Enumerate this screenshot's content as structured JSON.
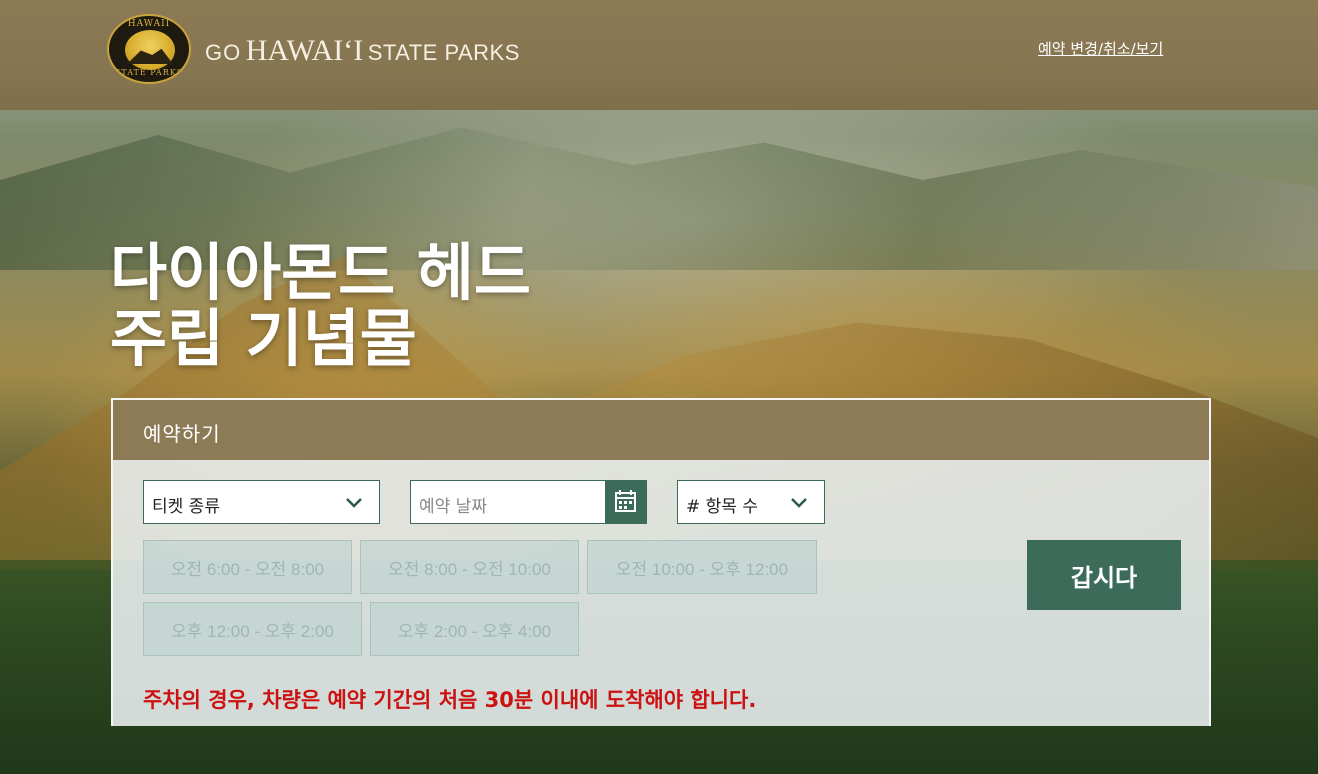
{
  "header": {
    "logo_top_text": "HAWAII",
    "logo_bottom_text": "STATE PARKS",
    "brand_go": "GO",
    "brand_hawaii": "HAWAIʻI",
    "brand_parks": "STATE PARKS",
    "manage_link": "예약 변경/취소/보기"
  },
  "hero": {
    "title_line1": "다이아몬드 헤드",
    "title_line2": "주립 기념물"
  },
  "booking": {
    "heading": "예약하기",
    "ticket_type": "티켓 종류",
    "date_placeholder": "예약 날짜",
    "quantity": "# 항목 수",
    "time_slots": [
      "오전 6:00 - 오전 8:00",
      "오전 8:00 - 오전 10:00",
      "오전 10:00 - 오후 12:00",
      "오후 12:00 - 오후 2:00",
      "오후 2:00 - 오후 4:00"
    ],
    "go_button": "갑시다",
    "notice": "주차의 경우, 차량은 예약 기간의 처음 30분 이내에 도착해야 합니다."
  },
  "colors": {
    "header_bg": "#857550",
    "accent_green": "#3c6b5a",
    "notice_red": "#cc1111"
  }
}
